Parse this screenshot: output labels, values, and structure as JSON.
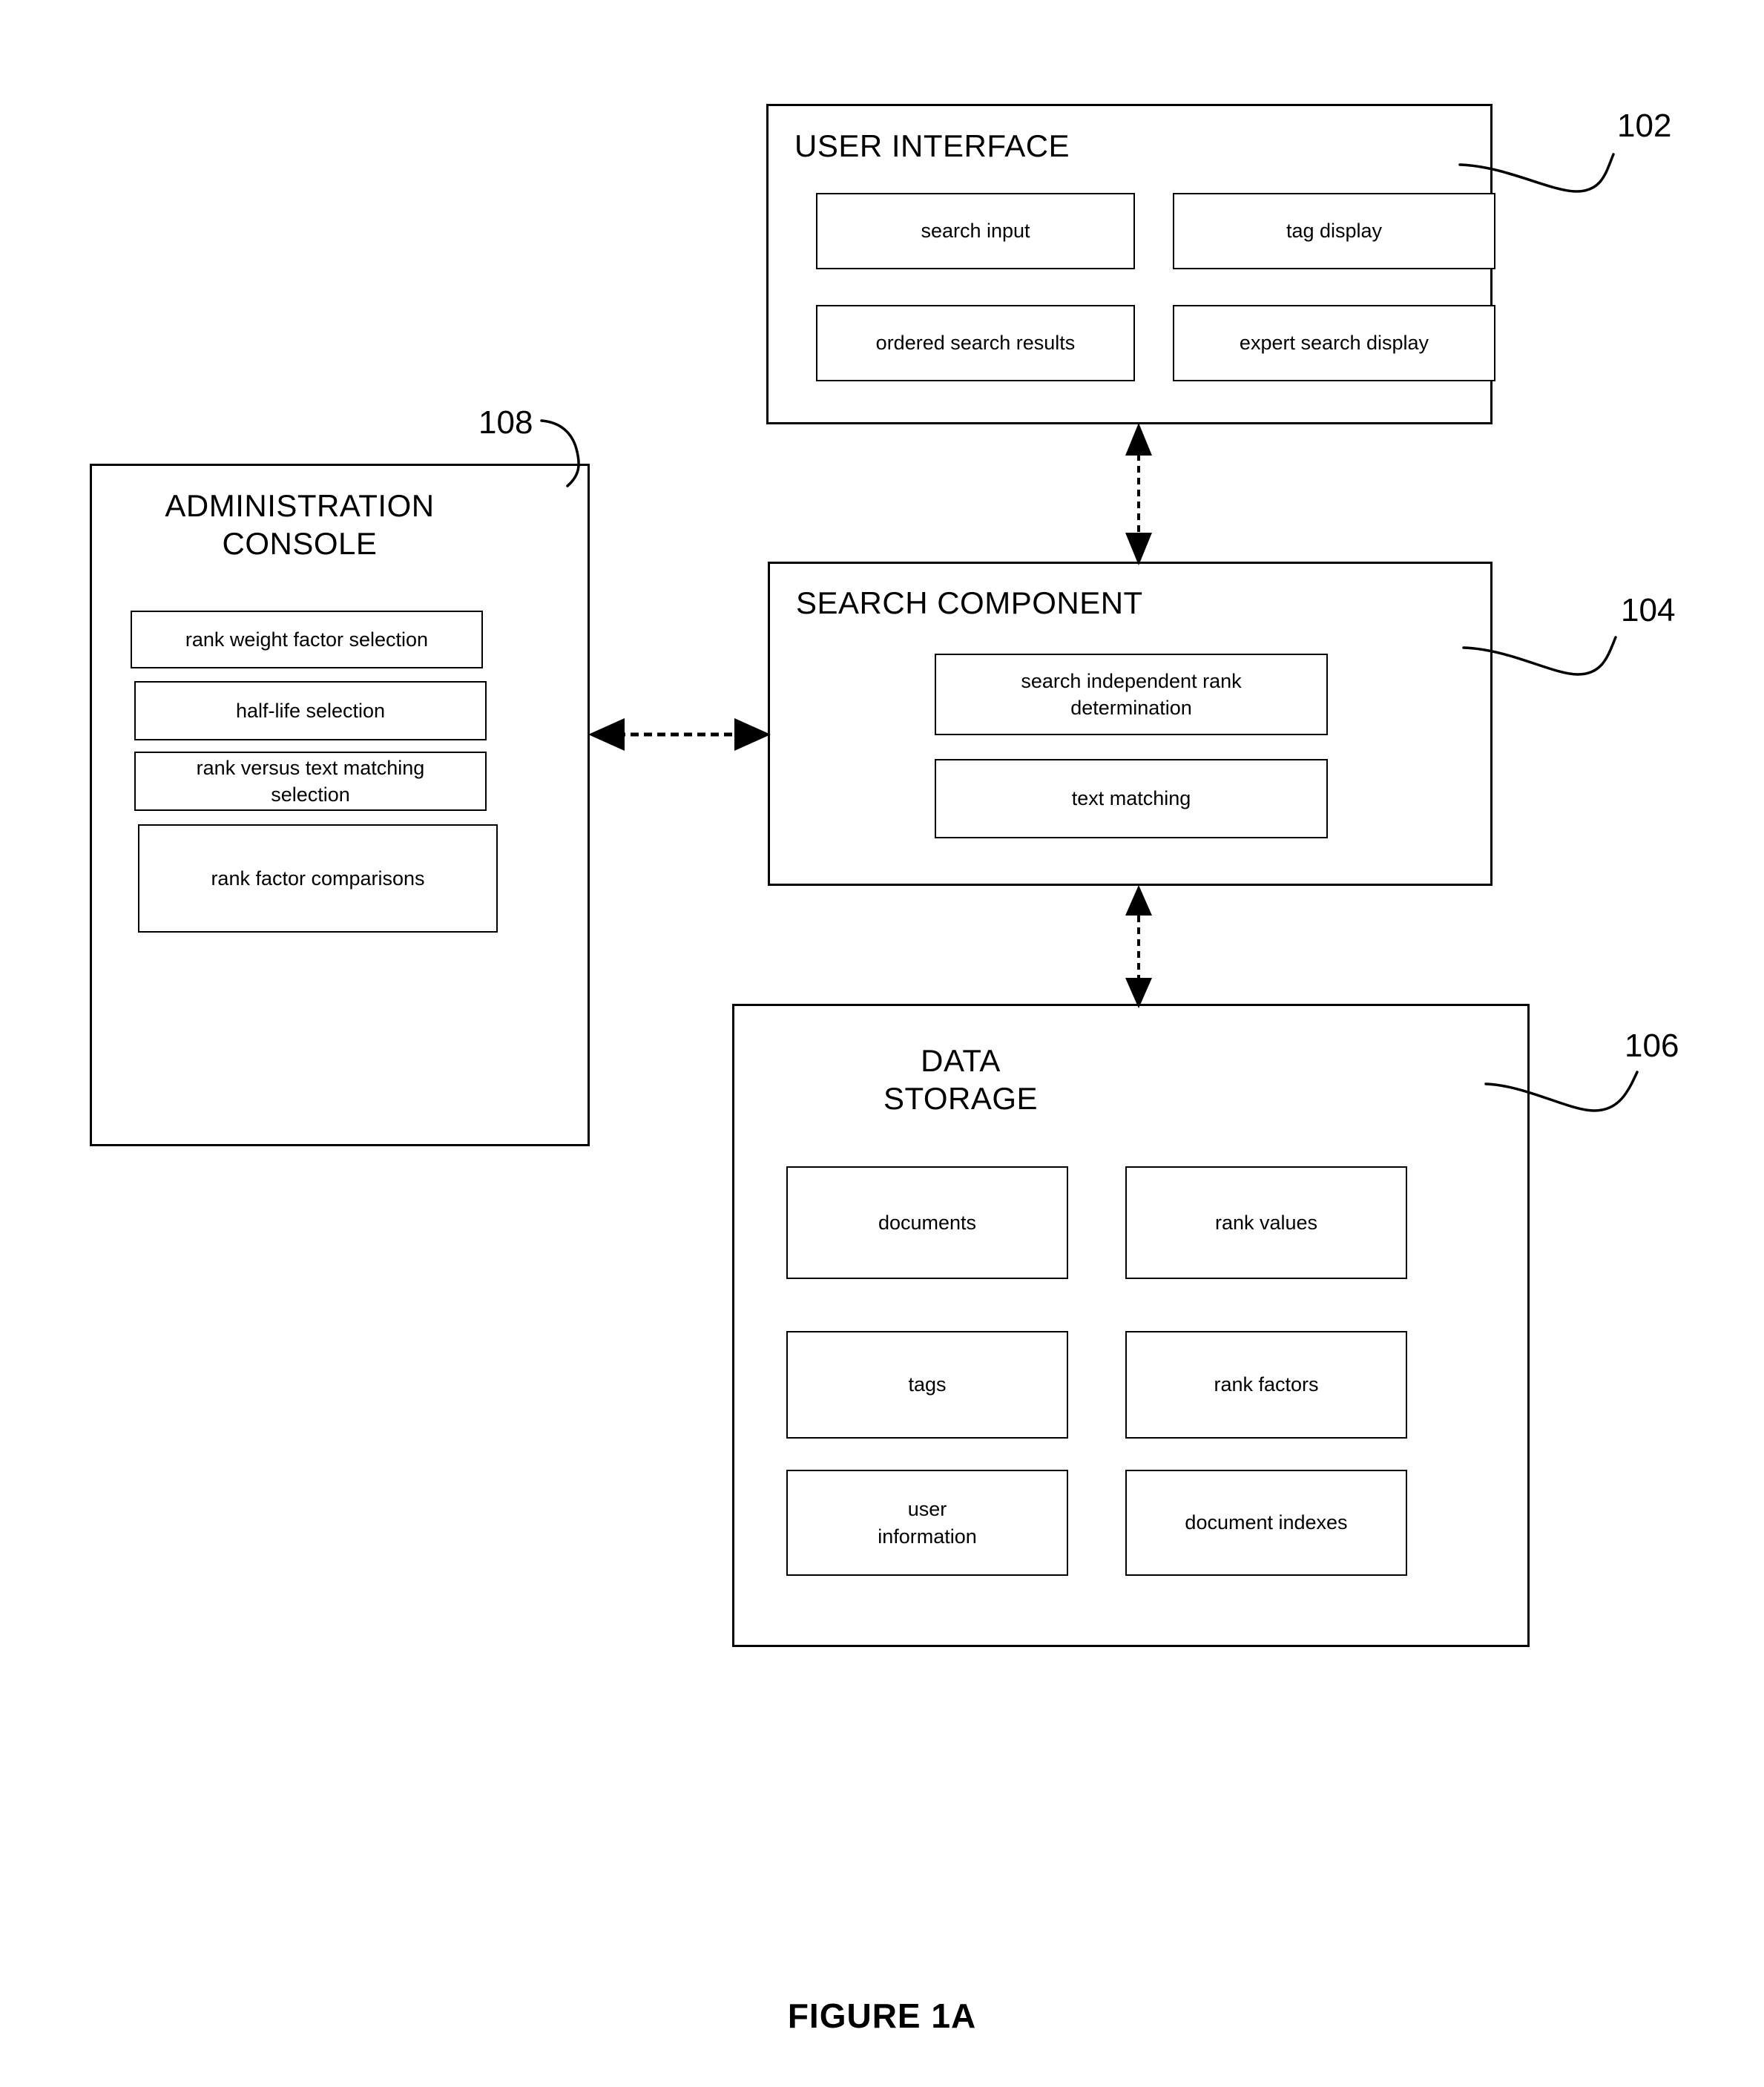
{
  "figure": {
    "caption": "FIGURE 1A"
  },
  "components": {
    "user_interface": {
      "title": "USER INTERFACE",
      "ref": "102",
      "items": [
        {
          "label": "search input"
        },
        {
          "label": "tag display"
        },
        {
          "label": "ordered search results"
        },
        {
          "label": "expert search display"
        }
      ]
    },
    "administration_console": {
      "title": "ADMINISTRATION\nCONSOLE",
      "ref": "108",
      "items": [
        {
          "label": "rank weight factor selection"
        },
        {
          "label": "half-life selection"
        },
        {
          "label": "rank versus text matching\nselection"
        },
        {
          "label": "rank factor comparisons"
        }
      ]
    },
    "search_component": {
      "title": "SEARCH COMPONENT",
      "ref": "104",
      "items": [
        {
          "label": "search independent rank\ndetermination"
        },
        {
          "label": "text matching"
        }
      ]
    },
    "data_storage": {
      "title": "DATA\nSTORAGE",
      "ref": "106",
      "items": [
        {
          "label": "documents"
        },
        {
          "label": "rank values"
        },
        {
          "label": "tags"
        },
        {
          "label": "rank factors"
        },
        {
          "label": "user\ninformation"
        },
        {
          "label": "document indexes"
        }
      ]
    }
  },
  "connectors": [
    {
      "name": "ui-to-search",
      "style": "double-headed-vertical"
    },
    {
      "name": "search-to-storage",
      "style": "double-headed-vertical"
    },
    {
      "name": "admin-to-search",
      "style": "double-headed-horizontal-dashed"
    }
  ],
  "colors": {
    "stroke": "#000000",
    "background": "#ffffff"
  }
}
